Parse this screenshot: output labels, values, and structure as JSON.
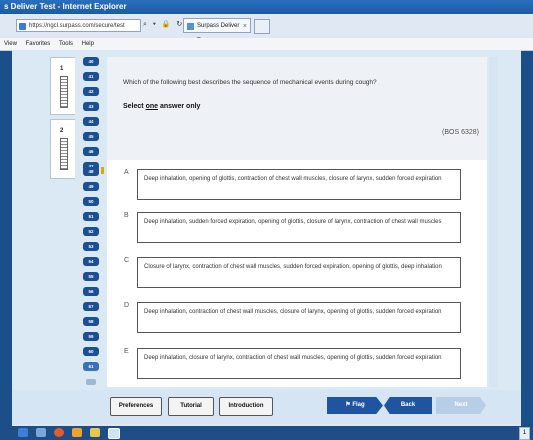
{
  "window": {
    "title": "s Deliver Test - Internet Explorer"
  },
  "browser": {
    "address": "https://ngcl.surpass.com/secure/test",
    "tab_label": "Surpass Deliver Test",
    "menu": [
      "View",
      "Favorites",
      "Tools",
      "Help"
    ]
  },
  "sections": [
    {
      "num": "1"
    },
    {
      "num": "2"
    }
  ],
  "nav": {
    "questions": [
      "40",
      "41",
      "42",
      "43",
      "44",
      "45",
      "46",
      "47",
      "48",
      "49",
      "50",
      "51",
      "52",
      "53",
      "54",
      "55",
      "56",
      "57",
      "58",
      "59",
      "60",
      "61"
    ],
    "current": "61",
    "flagged": "48"
  },
  "question": {
    "text": "Which of the following best describes the sequence of mechanical events during cough?",
    "instruction_pre": "Select ",
    "instruction_u": "one",
    "instruction_post": " answer only",
    "id": "(BOS 6328)"
  },
  "options": [
    {
      "letter": "A",
      "text": "Deep inhalation, opening of glottis, contraction of chest wall muscles, closure of larynx, sudden forced expiration"
    },
    {
      "letter": "B",
      "text": "Deep inhalation, sudden forced expiration, opening of glottis, closure of larynx, contraction of chest wall muscles"
    },
    {
      "letter": "C",
      "text": "Closure of larynx, contraction of chest wall muscles, sudden forced expiration, opening of glottis, deep inhalation"
    },
    {
      "letter": "D",
      "text": "Deep inhalation, contraction of chest wall muscles, closure of larynx, opening of glottis, sudden forced expiration"
    },
    {
      "letter": "E",
      "text": "Deep inhalation, closure of larynx, contraction of chest wall muscles, opening of glottis, sudden forced expiration"
    }
  ],
  "buttons": {
    "preferences": "Preferences",
    "tutorial": "Tutorial",
    "introduction": "Introduction",
    "flag": "Flag",
    "back": "Back",
    "next": "Next"
  },
  "taskbar": {
    "tray_label": "1"
  }
}
